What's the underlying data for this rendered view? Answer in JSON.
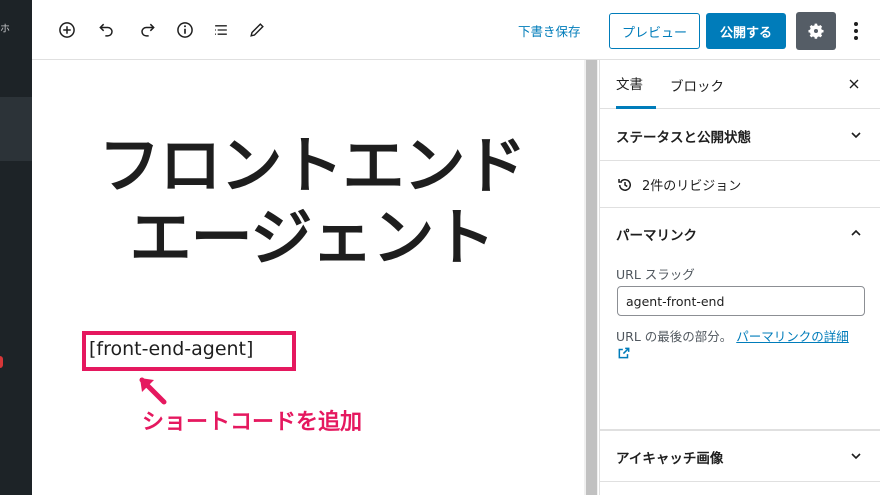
{
  "admin_sidebar": {
    "fragment_text": "ホ"
  },
  "toolbar": {
    "icons": [
      "add-block-icon",
      "undo-icon",
      "redo-icon",
      "info-icon",
      "list-view-icon",
      "tools-pencil-icon"
    ],
    "save_draft_label": "下書き保存",
    "preview_label": "プレビュー",
    "publish_label": "公開する",
    "settings_icon": "gear-icon",
    "more_icon": "more-vertical-icon"
  },
  "editor": {
    "title_line1": "フロントエンド",
    "title_line2": "エージェント",
    "shortcode": "[front-end-agent]",
    "annotation": "ショートコードを追加",
    "annotation_color": "#e5185f"
  },
  "sidebar": {
    "tabs": [
      {
        "label": "文書",
        "active": true
      },
      {
        "label": "ブロック",
        "active": false
      }
    ],
    "panels": {
      "status": "ステータスと公開状態",
      "revisions": "2件のリビジョン",
      "permalink": "パーマリンク",
      "featured_image": "アイキャッチ画像"
    },
    "permalink": {
      "url_slug_label": "URL スラッグ",
      "slug_value": "agent-front-end",
      "help_prefix": "URL の最後の部分。",
      "help_link": "パーマリンクの詳細"
    }
  },
  "colors": {
    "accent": "#007cba",
    "admin_bar": "#1d2327",
    "settings_button": "#555d66"
  }
}
